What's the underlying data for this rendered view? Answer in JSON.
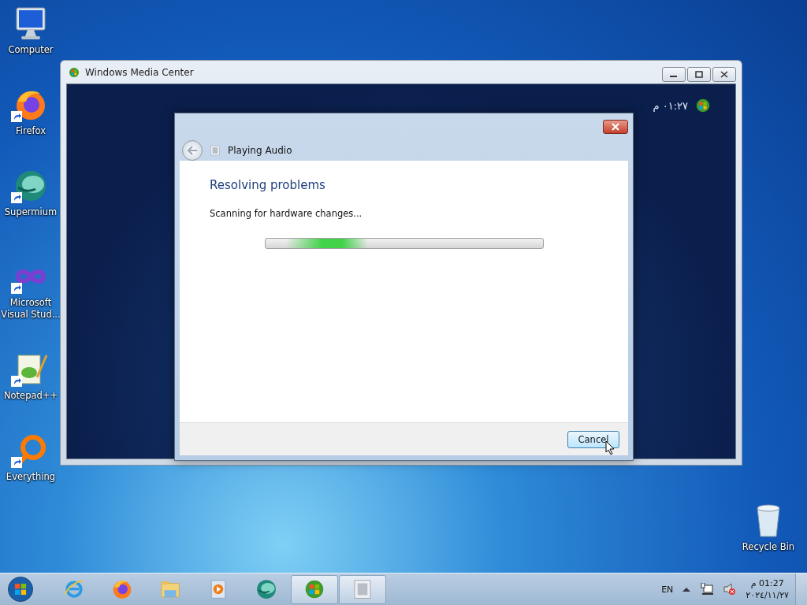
{
  "desktop_icons": [
    {
      "kind": "computer",
      "label": "Computer",
      "shortcut": false
    },
    {
      "kind": "firefox",
      "label": "Firefox",
      "shortcut": true
    },
    {
      "kind": "supermium",
      "label": "Supermium",
      "shortcut": true
    },
    {
      "kind": "vs",
      "label": "Microsoft Visual Stud...",
      "shortcut": true
    },
    {
      "kind": "notepad",
      "label": "Notepad++",
      "shortcut": true
    },
    {
      "kind": "everything",
      "label": "Everything",
      "shortcut": true
    }
  ],
  "recycle_bin": {
    "label": "Recycle Bin"
  },
  "media_center_window": {
    "title": "Windows Media Center",
    "clock": "٠١:٢٧ م"
  },
  "dialog": {
    "title": "Playing Audio",
    "heading": "Resolving problems",
    "status": "Scanning for hardware changes...",
    "progress": {
      "level": 0.37
    },
    "button": "Cancel"
  },
  "taskbar": {
    "items": [
      {
        "kind": "ie",
        "running": false
      },
      {
        "kind": "firefox",
        "running": false
      },
      {
        "kind": "explorer",
        "running": false
      },
      {
        "kind": "media",
        "running": false
      },
      {
        "kind": "supermium",
        "running": false
      },
      {
        "kind": "mediacenter",
        "running": true
      },
      {
        "kind": "troubleshooter",
        "running": true
      }
    ],
    "language": "EN",
    "time": "01:27 م",
    "date": "٢٠٢٤/١١/٢٧"
  }
}
